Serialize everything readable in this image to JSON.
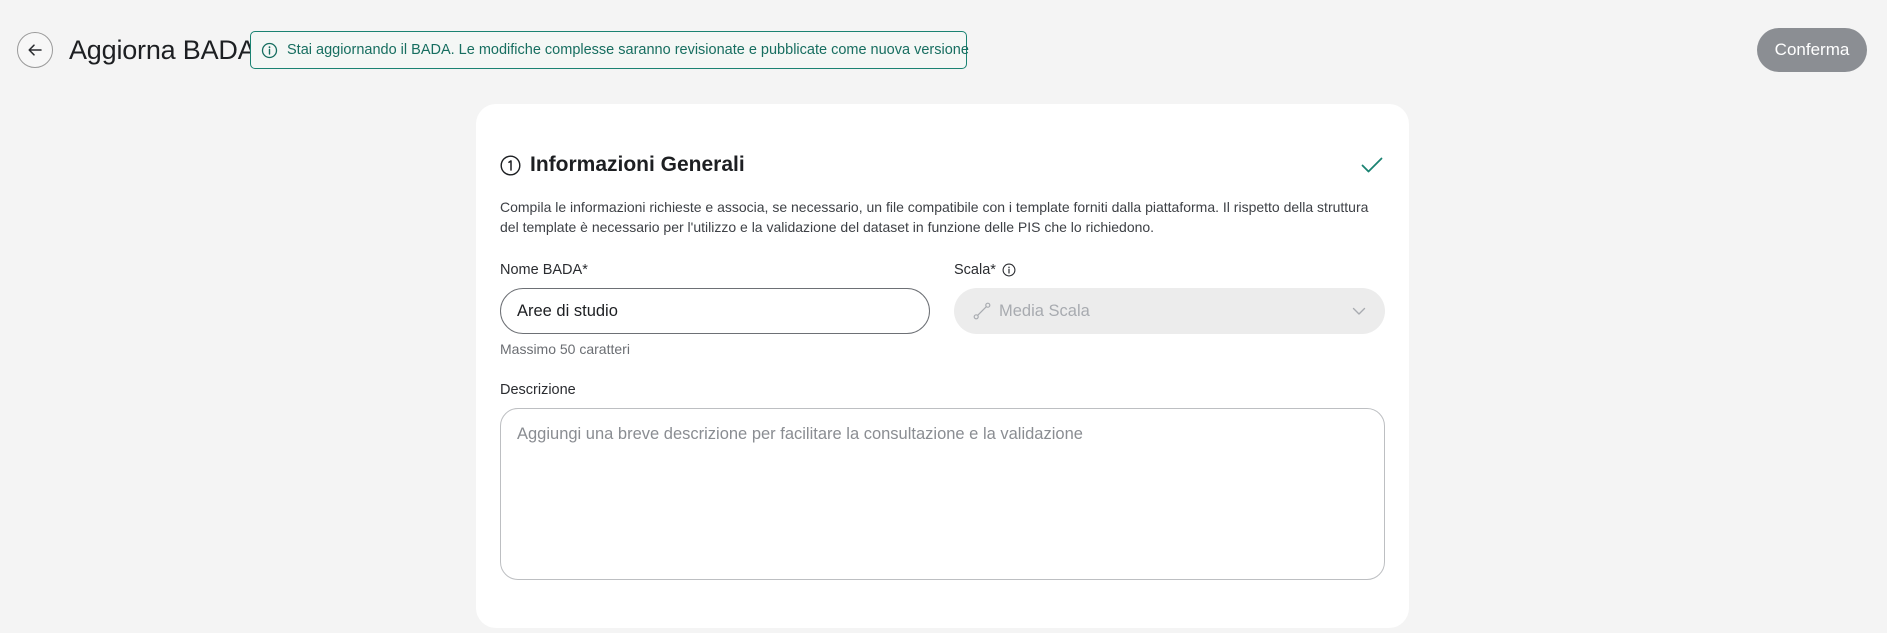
{
  "header": {
    "back_icon": "arrow-left-icon",
    "title": "Aggiorna BADA",
    "banner": {
      "icon": "info-circle-icon",
      "text": "Stai aggiornando il BADA. Le modifiche complesse saranno revisionate e pubblicate come nuova versione"
    },
    "confirm_label": "Conferma"
  },
  "section": {
    "step_icon": "circled-one-icon",
    "title": "Informazioni Generali",
    "status_icon": "checkmark-icon",
    "description": "Compila le informazioni richieste e associa, se necessario, un file compatibile con i template forniti dalla piattaforma. Il rispetto della struttura del template è necessario per l'utilizzo e la validazione del dataset in funzione delle PIS che lo richiedono."
  },
  "form": {
    "name": {
      "label": "Nome BADA*",
      "value": "Aree di studio",
      "hint": "Massimo 50 caratteri"
    },
    "scale": {
      "label": "Scala*",
      "label_icon": "info-circle-icon",
      "icon": "ruler-line-icon",
      "selected": "Media Scala",
      "chevron_icon": "chevron-down-icon"
    },
    "description": {
      "label": "Descrizione",
      "placeholder": "Aggiungi una breve descrizione per facilitare la consultazione e la validazione",
      "value": ""
    }
  },
  "colors": {
    "accent_green": "#1a8372",
    "button_disabled": "#8b8e93",
    "page_bg": "#f4f4f4"
  }
}
